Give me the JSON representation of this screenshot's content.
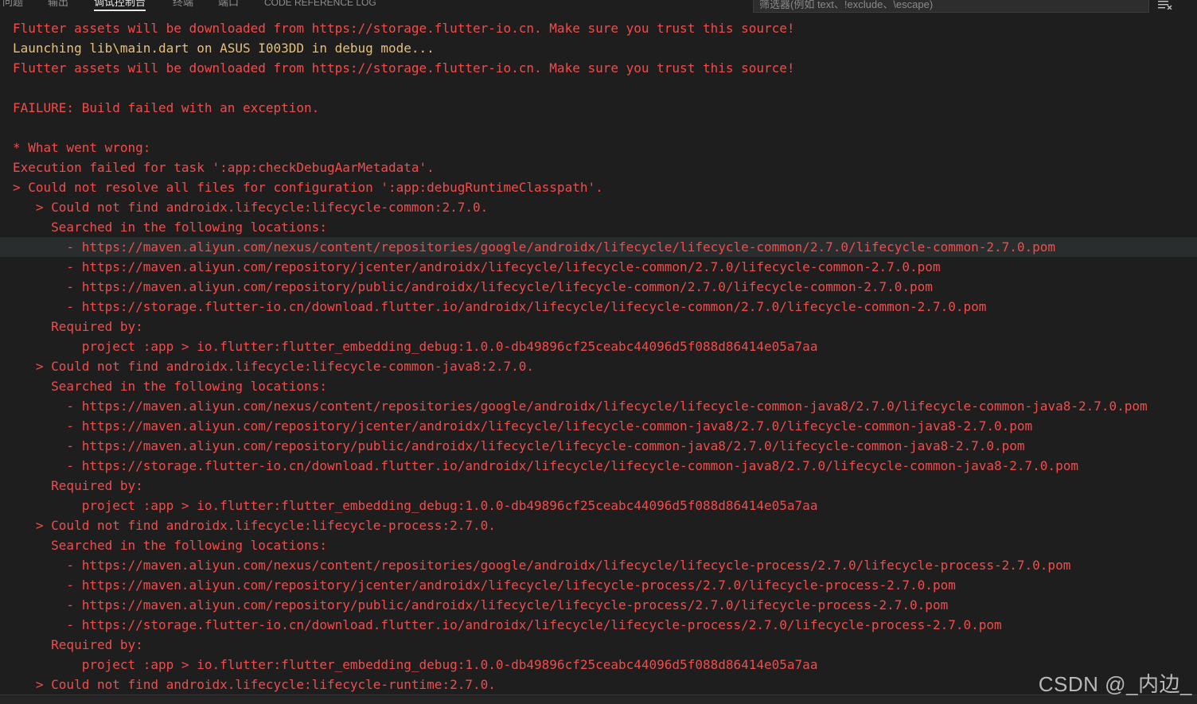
{
  "panel": {
    "tabs": [
      {
        "label": "问题"
      },
      {
        "label": "输出"
      },
      {
        "label": "调试控制台"
      },
      {
        "label": "终端"
      },
      {
        "label": "端口"
      },
      {
        "label": "CODE REFERENCE LOG"
      }
    ],
    "active_tab": "调试控制台",
    "filter_placeholder": "筛选器(例如 text、!exclude、\\escape)",
    "toolbar_icon": "clear-console-icon"
  },
  "console": {
    "lines": [
      {
        "text": "Flutter assets will be downloaded from https://storage.flutter-io.cn. Make sure you trust this source!",
        "kind": "error"
      },
      {
        "text": "Launching lib\\main.dart on ASUS I003DD in debug mode...",
        "kind": "warn"
      },
      {
        "text": "Flutter assets will be downloaded from https://storage.flutter-io.cn. Make sure you trust this source!",
        "kind": "error"
      },
      {
        "text": "",
        "kind": "error"
      },
      {
        "text": "FAILURE: Build failed with an exception.",
        "kind": "error"
      },
      {
        "text": "",
        "kind": "error"
      },
      {
        "text": "* What went wrong:",
        "kind": "error"
      },
      {
        "text": "Execution failed for task ':app:checkDebugAarMetadata'.",
        "kind": "error"
      },
      {
        "text": "> Could not resolve all files for configuration ':app:debugRuntimeClasspath'.",
        "kind": "error"
      },
      {
        "text": "   > Could not find androidx.lifecycle:lifecycle-common:2.7.0.",
        "kind": "error"
      },
      {
        "text": "     Searched in the following locations:",
        "kind": "error"
      },
      {
        "text": "       - https://maven.aliyun.com/nexus/content/repositories/google/androidx/lifecycle/lifecycle-common/2.7.0/lifecycle-common-2.7.0.pom",
        "kind": "error",
        "highlighted": true
      },
      {
        "text": "       - https://maven.aliyun.com/repository/jcenter/androidx/lifecycle/lifecycle-common/2.7.0/lifecycle-common-2.7.0.pom",
        "kind": "error"
      },
      {
        "text": "       - https://maven.aliyun.com/repository/public/androidx/lifecycle/lifecycle-common/2.7.0/lifecycle-common-2.7.0.pom",
        "kind": "error"
      },
      {
        "text": "       - https://storage.flutter-io.cn/download.flutter.io/androidx/lifecycle/lifecycle-common/2.7.0/lifecycle-common-2.7.0.pom",
        "kind": "error"
      },
      {
        "text": "     Required by:",
        "kind": "error"
      },
      {
        "text": "         project :app > io.flutter:flutter_embedding_debug:1.0.0-db49896cf25ceabc44096d5f088d86414e05a7aa",
        "kind": "error"
      },
      {
        "text": "   > Could not find androidx.lifecycle:lifecycle-common-java8:2.7.0.",
        "kind": "error"
      },
      {
        "text": "     Searched in the following locations:",
        "kind": "error"
      },
      {
        "text": "       - https://maven.aliyun.com/nexus/content/repositories/google/androidx/lifecycle/lifecycle-common-java8/2.7.0/lifecycle-common-java8-2.7.0.pom",
        "kind": "error"
      },
      {
        "text": "       - https://maven.aliyun.com/repository/jcenter/androidx/lifecycle/lifecycle-common-java8/2.7.0/lifecycle-common-java8-2.7.0.pom",
        "kind": "error"
      },
      {
        "text": "       - https://maven.aliyun.com/repository/public/androidx/lifecycle/lifecycle-common-java8/2.7.0/lifecycle-common-java8-2.7.0.pom",
        "kind": "error"
      },
      {
        "text": "       - https://storage.flutter-io.cn/download.flutter.io/androidx/lifecycle/lifecycle-common-java8/2.7.0/lifecycle-common-java8-2.7.0.pom",
        "kind": "error"
      },
      {
        "text": "     Required by:",
        "kind": "error"
      },
      {
        "text": "         project :app > io.flutter:flutter_embedding_debug:1.0.0-db49896cf25ceabc44096d5f088d86414e05a7aa",
        "kind": "error"
      },
      {
        "text": "   > Could not find androidx.lifecycle:lifecycle-process:2.7.0.",
        "kind": "error"
      },
      {
        "text": "     Searched in the following locations:",
        "kind": "error"
      },
      {
        "text": "       - https://maven.aliyun.com/nexus/content/repositories/google/androidx/lifecycle/lifecycle-process/2.7.0/lifecycle-process-2.7.0.pom",
        "kind": "error"
      },
      {
        "text": "       - https://maven.aliyun.com/repository/jcenter/androidx/lifecycle/lifecycle-process/2.7.0/lifecycle-process-2.7.0.pom",
        "kind": "error"
      },
      {
        "text": "       - https://maven.aliyun.com/repository/public/androidx/lifecycle/lifecycle-process/2.7.0/lifecycle-process-2.7.0.pom",
        "kind": "error"
      },
      {
        "text": "       - https://storage.flutter-io.cn/download.flutter.io/androidx/lifecycle/lifecycle-process/2.7.0/lifecycle-process-2.7.0.pom",
        "kind": "error"
      },
      {
        "text": "     Required by:",
        "kind": "error"
      },
      {
        "text": "         project :app > io.flutter:flutter_embedding_debug:1.0.0-db49896cf25ceabc44096d5f088d86414e05a7aa",
        "kind": "error"
      },
      {
        "text": "   > Could not find androidx.lifecycle:lifecycle-runtime:2.7.0.",
        "kind": "error"
      }
    ]
  },
  "watermark": "CSDN @_内边_",
  "colors": {
    "background": "#1e1e1e",
    "error_text": "#f14c4c",
    "warn_text": "#e5c07b",
    "highlight_row": "#2a2d2e"
  }
}
